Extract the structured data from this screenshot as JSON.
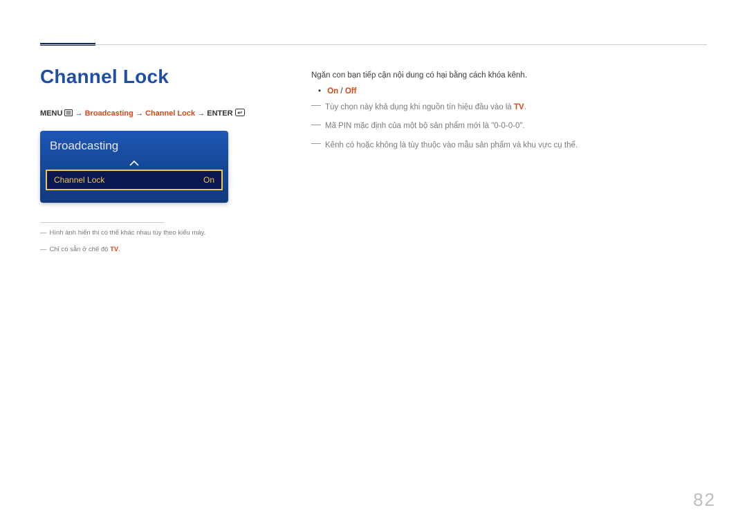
{
  "page": {
    "title": "Channel Lock",
    "number": "82"
  },
  "path": {
    "menu_label": "MENU",
    "arrow": " → ",
    "seg_broadcasting": "Broadcasting",
    "seg_channel_lock": "Channel Lock",
    "enter_label": "ENTER"
  },
  "osd": {
    "title": "Broadcasting",
    "row": {
      "label": "Channel Lock",
      "value": "On"
    }
  },
  "footnotes": {
    "f1": "Hình ảnh hiển thị có thể khác nhau tùy theo kiểu máy.",
    "f2_prefix": "Chỉ có sẵn ở chế độ ",
    "f2_tv": "TV",
    "f2_suffix": "."
  },
  "right": {
    "lead": "Ngăn con bạn tiếp cận nội dung có hại bằng cách khóa kênh.",
    "on_label": "On",
    "slash": " / ",
    "off_label": "Off",
    "note1_prefix": "Tùy chọn này khả dụng khi nguồn tín hiệu đầu vào là ",
    "note1_tv": "TV",
    "note1_suffix": ".",
    "note2": "Mã PIN mặc định của một bộ sản phẩm mới là \"0-0-0-0\".",
    "note3": "Kênh có hoặc không là tùy thuộc vào mẫu sản phẩm và khu vực cụ thể."
  }
}
